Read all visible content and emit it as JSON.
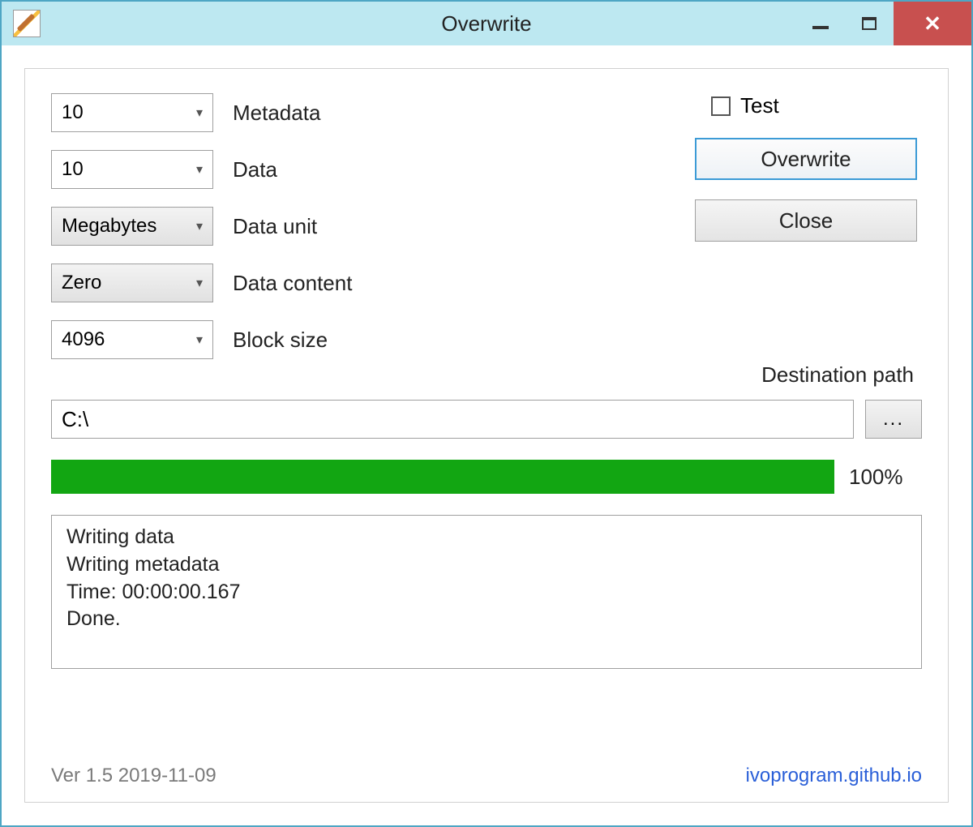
{
  "window": {
    "title": "Overwrite"
  },
  "fields": {
    "metadata": {
      "value": "10",
      "label": "Metadata"
    },
    "data": {
      "value": "10",
      "label": "Data"
    },
    "data_unit": {
      "value": "Megabytes",
      "label": "Data unit"
    },
    "data_content": {
      "value": "Zero",
      "label": "Data content"
    },
    "block_size": {
      "value": "4096",
      "label": "Block size"
    }
  },
  "test_checkbox": {
    "label": "Test",
    "checked": false
  },
  "buttons": {
    "overwrite": "Overwrite",
    "close": "Close",
    "browse": "..."
  },
  "destination": {
    "label": "Destination path",
    "value": "C:\\"
  },
  "progress": {
    "percent_text": "100%",
    "percent_value": 100
  },
  "log": "Writing data\nWriting metadata\nTime: 00:00:00.167\nDone.",
  "footer": {
    "version": "Ver 1.5 2019-11-09",
    "link": "ivoprogram.github.io"
  }
}
